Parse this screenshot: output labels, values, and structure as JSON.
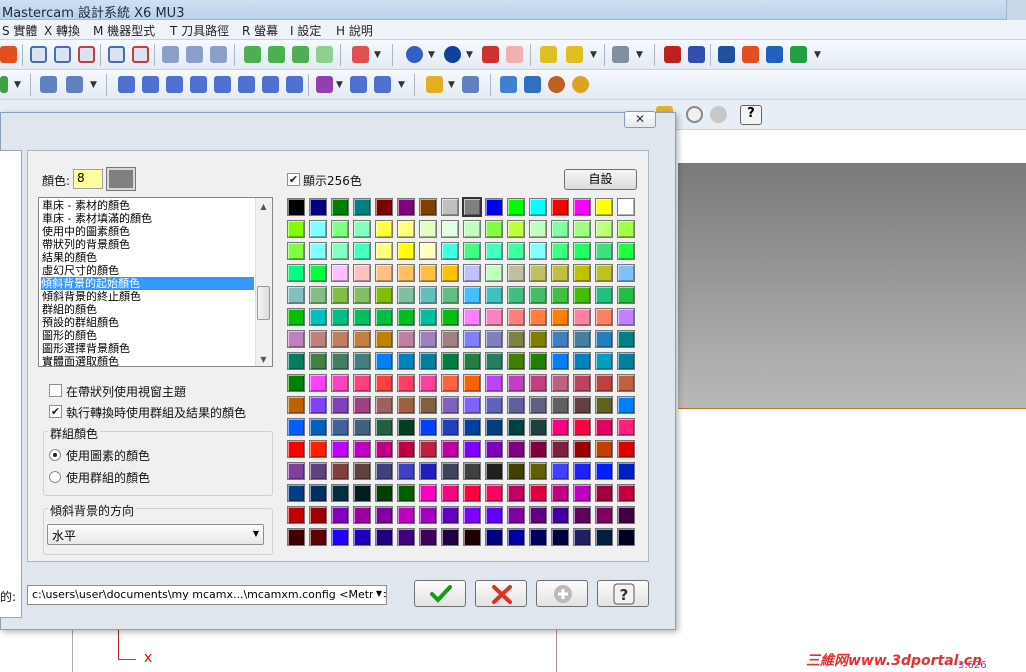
{
  "window": {
    "title": "Mastercam 設計系統 X6 MU3"
  },
  "menu": [
    "S 實體",
    "X 轉換",
    "M 機器型式",
    "T 刀具路徑",
    "R 螢幕",
    "I 設定",
    "H 說明"
  ],
  "dialog": {
    "close_glyph": "✕",
    "color_label": "顏色:",
    "color_index": "8",
    "show256_label": "顯示256色",
    "show256_checked": true,
    "customize_label": "自設",
    "list_items": [
      "車床 - 素材的顏色",
      "車床 - 素材填滿的顏色",
      "使用中的圖素顏色",
      "帶狀列的背景顏色",
      "結果的顏色",
      "虛幻尺寸的顏色",
      "傾斜背景的起始顏色",
      "傾斜背景的終止顏色",
      "群組的顏色",
      "預設的群組顏色",
      "圖形的顏色",
      "圖形選擇背景顏色",
      "實體面選取顏色"
    ],
    "selected_item": "傾斜背景的起始顏色",
    "options": {
      "theme_label": "在帶狀列使用視窗主題",
      "theme_checked": false,
      "xform_label": "執行轉換時使用群組及結果的顏色",
      "xform_checked": true
    },
    "group_colors": {
      "title": "群組顏色",
      "entity_label": "使用圖素的顏色",
      "group_label": "使用群組的顏色",
      "selected": "entity"
    },
    "gradient_dir": {
      "title": "傾斜背景的方向",
      "value": "水平"
    },
    "path_prefix": "的:",
    "path_value": "c:\\users\\user\\documents\\my mcamx...\\mcamxm.config <Metric> <_>",
    "palette": [
      [
        "#000000",
        "#000080",
        "#008000",
        "#008080",
        "#800000",
        "#800080",
        "#804000",
        "#c0c0c0",
        "#808080",
        "#0000ff",
        "#00ff00",
        "#00ffff",
        "#ff0000",
        "#ff00ff",
        "#ffff00",
        "#ffffff"
      ],
      [
        "#80ff00",
        "#80ffff",
        "#80ff80",
        "#80ffc0",
        "#ffff40",
        "#ffff80",
        "#e0ffc0",
        "#e0ffe0",
        "#c0ffc0",
        "#80ff40",
        "#c0ff40",
        "#c0ffc0",
        "#80ffa0",
        "#a0ff80",
        "#c0ff80",
        "#a0ff40"
      ],
      [
        "#80ff40",
        "#80ffff",
        "#80ffc0",
        "#40ffc0",
        "#ffff80",
        "#ffff00",
        "#ffffc0",
        "#40ffe0",
        "#40ff80",
        "#40ffc0",
        "#40ffa0",
        "#80ffff",
        "#40ff80",
        "#20ff60",
        "#40e080",
        "#20ff40"
      ],
      [
        "#00ff80",
        "#00ff40",
        "#ffc0ff",
        "#ffc0c0",
        "#ffc080",
        "#ffc060",
        "#ffc040",
        "#ffc000",
        "#c0c0ff",
        "#c0ffc0",
        "#c0c0a0",
        "#c0c060",
        "#c0c040",
        "#c0c000",
        "#c0c020",
        "#80c0ff"
      ],
      [
        "#80c0c0",
        "#80c080",
        "#80c040",
        "#80c060",
        "#80c000",
        "#80c0a0",
        "#60c0c0",
        "#60c080",
        "#40c0ff",
        "#40c0c0",
        "#40c080",
        "#40c060",
        "#40c040",
        "#40c000",
        "#20c080",
        "#20c040"
      ],
      [
        "#00c000",
        "#00c0c0",
        "#00c080",
        "#00c060",
        "#00c040",
        "#00c020",
        "#00c0a0",
        "#00c010",
        "#ff80ff",
        "#ff80c0",
        "#ff8080",
        "#ff8040",
        "#ff8000",
        "#ff80a0",
        "#ff8060",
        "#c080ff"
      ],
      [
        "#c080c0",
        "#c08080",
        "#c08060",
        "#c08040",
        "#c08000",
        "#c080a0",
        "#a080c0",
        "#a08080",
        "#8080ff",
        "#8080c0",
        "#808040",
        "#808000",
        "#4080c0",
        "#4080a0",
        "#2080c0",
        "#008080"
      ],
      [
        "#008060",
        "#408040",
        "#408060",
        "#408080",
        "#0080ff",
        "#0080c0",
        "#0080a0",
        "#008040",
        "#208040",
        "#208060",
        "#408000",
        "#208000",
        "#0080ff",
        "#0080c0",
        "#00a0c0",
        "#0080a0"
      ],
      [
        "#008000",
        "#ff40ff",
        "#ff40c0",
        "#ff4080",
        "#ff4040",
        "#ff4060",
        "#ff40a0",
        "#ff6040",
        "#ff6000",
        "#c040ff",
        "#c040c0",
        "#c04080",
        "#c06080",
        "#c04060",
        "#c04040",
        "#c06040"
      ],
      [
        "#c06000",
        "#8040ff",
        "#8040c0",
        "#a04080",
        "#a06060",
        "#a06040",
        "#806040",
        "#8060c0",
        "#8060ff",
        "#6060c0",
        "#6060a0",
        "#606080",
        "#606060",
        "#604040",
        "#606020",
        "#0080ff"
      ],
      [
        "#0060ff",
        "#0060c0",
        "#4060a0",
        "#406080",
        "#206040",
        "#004020",
        "#0040ff",
        "#2040c0",
        "#0040a0",
        "#004080",
        "#004040",
        "#204040",
        "#ff0080",
        "#ff0040",
        "#e00060",
        "#ff2080"
      ],
      [
        "#ff0000",
        "#ff2000",
        "#c000ff",
        "#c000c0",
        "#c00080",
        "#c00040",
        "#c02040",
        "#c000a0",
        "#8000ff",
        "#8000c0",
        "#800080",
        "#800040",
        "#802040",
        "#a00000",
        "#c04000",
        "#e00000"
      ],
      [
        "#8040a0",
        "#604080",
        "#804040",
        "#604040",
        "#404080",
        "#4040c0",
        "#2020c0",
        "#404060",
        "#404040",
        "#202020",
        "#404000",
        "#606000",
        "#4040ff",
        "#2020ff",
        "#0020ff",
        "#0020c0"
      ],
      [
        "#004080",
        "#003060",
        "#003040",
        "#002020",
        "#004000",
        "#006000",
        "#ff00c0",
        "#ff0080",
        "#ff0040",
        "#ff0060",
        "#c00060",
        "#e00040",
        "#c00080",
        "#c000c0",
        "#a00040",
        "#c00040"
      ],
      [
        "#c00000",
        "#a00000",
        "#8000c0",
        "#a000a0",
        "#8000a0",
        "#c000c0",
        "#a000c0",
        "#6000c0",
        "#8000ff",
        "#6000ff",
        "#8000a0",
        "#600080",
        "#4000a0",
        "#600060",
        "#800060",
        "#400040"
      ],
      [
        "#400000",
        "#600000",
        "#2000ff",
        "#2000c0",
        "#200080",
        "#400080",
        "#400060",
        "#200040",
        "#200000",
        "#000080",
        "#0000a0",
        "#000060",
        "#000040",
        "#202060",
        "#002040",
        "#000020"
      ]
    ]
  },
  "viewport": {
    "axis_label": "x",
    "coord_label": "3.626"
  },
  "watermark": "三維网www.3dportal.cn"
}
